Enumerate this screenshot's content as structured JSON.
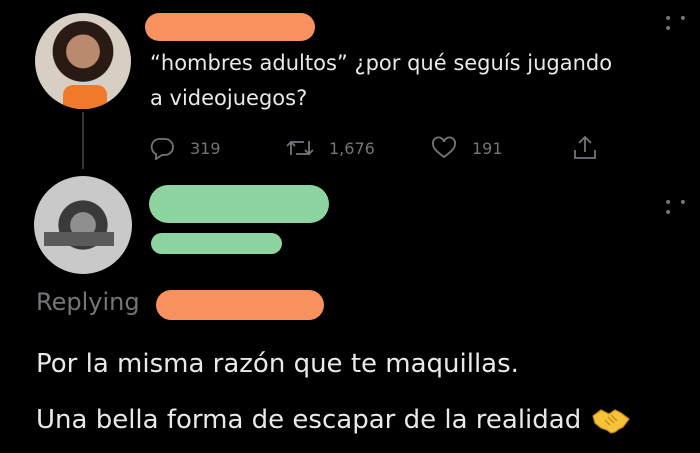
{
  "original_tweet": {
    "text_line1": "“hombres adultos” ¿por qué seguís jugando",
    "text_line2": "a videojuegos?",
    "stats": {
      "replies": "319",
      "retweets": "1,676",
      "likes": "191"
    }
  },
  "reply": {
    "replying_label": "Replying",
    "line1": "Por la misma razón que te maquillas.",
    "line2": "Una bella forma de escapar de la realidad"
  },
  "colors": {
    "redaction_orange": "#f9915e",
    "redaction_green": "#8ed4a0",
    "muted": "#71767b",
    "text": "#e7e9ea"
  },
  "icons": [
    "reply-icon",
    "retweet-icon",
    "like-icon",
    "share-icon",
    "more-icon",
    "handshake-icon"
  ]
}
